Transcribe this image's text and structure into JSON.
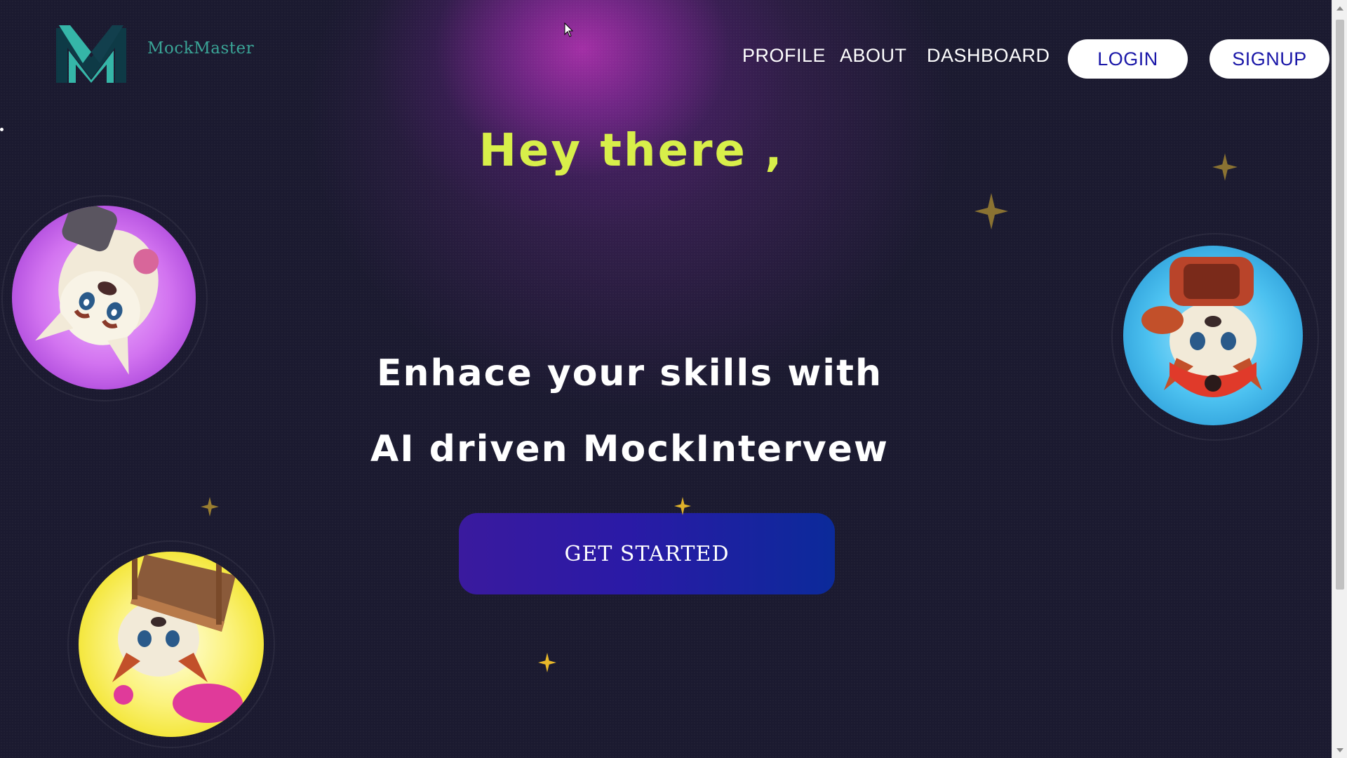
{
  "brand": {
    "name": "MockMaster",
    "logo_icon": "m-monogram-logo"
  },
  "nav": {
    "profile": "PROFILE",
    "about": "ABOUT",
    "dashboard": "DASHBOARD",
    "login": "LOGIN",
    "signup": "SIGNUP"
  },
  "hero": {
    "greeting": "Hey there ,",
    "tagline_line1": "Enhace your skills with",
    "tagline_line2": "AI driven MockIntervew",
    "cta": "GET STARTED"
  },
  "avatars": [
    {
      "name": "red-panda-avatar-purple",
      "bg": "#c247e6"
    },
    {
      "name": "red-panda-avatar-blue",
      "bg": "#3fb5ea"
    },
    {
      "name": "red-panda-avatar-yellow",
      "bg": "#f0e21f"
    }
  ],
  "colors": {
    "background": "#1b1a30",
    "greeting": "#d8ef4a",
    "brand": "#3aa597",
    "button_text": "#1a17a8",
    "cta_gradient_start": "#3a1a9e",
    "cta_gradient_end": "#0b2a9a",
    "sparkle": "#b8962e"
  }
}
